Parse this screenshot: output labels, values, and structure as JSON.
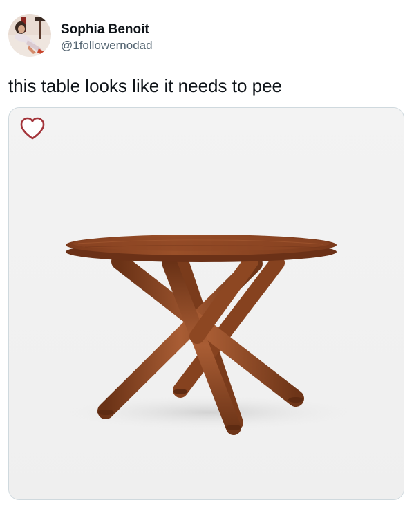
{
  "tweet": {
    "author": {
      "display_name": "Sophia Benoit",
      "handle": "@1followernodad"
    },
    "text": "this table looks like it needs to pee",
    "media": {
      "icons": {
        "like": "heart-outline-icon"
      }
    }
  },
  "colors": {
    "text_primary": "#0f1419",
    "text_secondary": "#536471",
    "media_border": "#cfd9de",
    "media_background": "#f2f2f2",
    "heart_outline": "#a3343a",
    "wood_dark": "#6e3518",
    "wood_mid": "#8f4a25",
    "wood_light": "#b0643a"
  }
}
